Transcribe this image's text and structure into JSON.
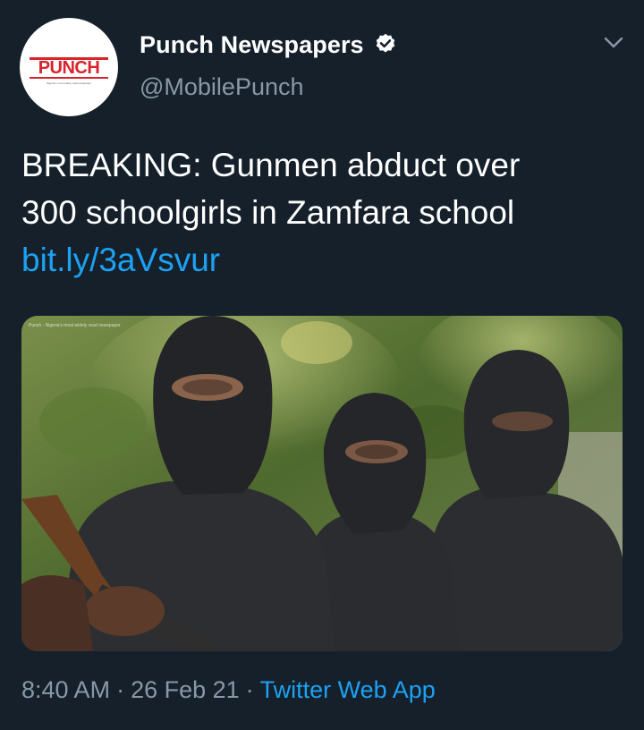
{
  "author": {
    "display_name": "Punch Newspapers",
    "handle": "@MobilePunch",
    "verified": true,
    "avatar_logo_text": "PUNCH",
    "avatar_tagline": "Nigeria's most widely read newspaper"
  },
  "tweet": {
    "text_lines": [
      "BREAKING: Gunmen abduct over",
      "300 schoolgirls in Zamfara school"
    ],
    "link": "bit.ly/3aVsvur"
  },
  "media": {
    "watermark": "Punch - Nigeria's most widely read newspaper"
  },
  "meta": {
    "time": "8:40 AM",
    "date": "26 Feb 21",
    "separator": "·",
    "source": "Twitter Web App"
  },
  "colors": {
    "background": "#15202b",
    "link": "#1da1f2",
    "secondary_text": "#8899a6",
    "brand_red": "#d9242b",
    "verified_badge": "#ffffff"
  },
  "icons": {
    "verified": "verified-badge-icon",
    "menu": "chevron-down-icon"
  }
}
